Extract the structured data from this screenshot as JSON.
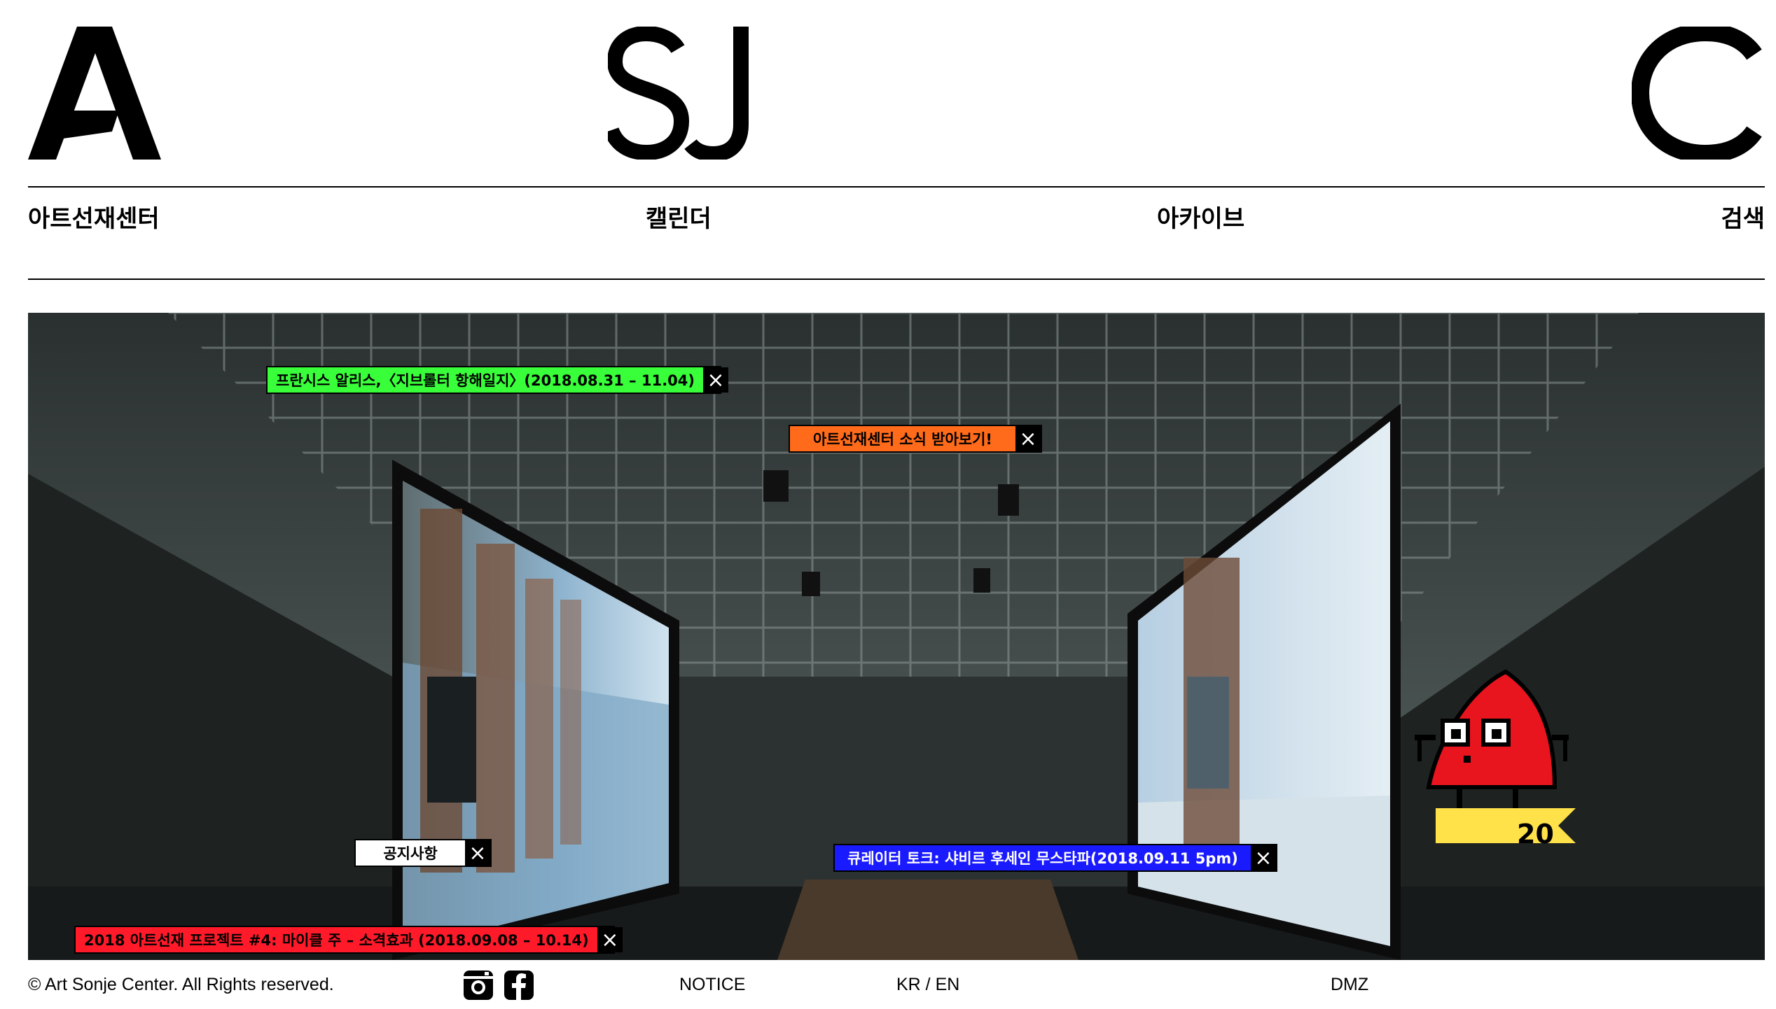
{
  "logo": {
    "letters": [
      "A",
      "SJ",
      "C"
    ]
  },
  "nav": {
    "items": [
      {
        "label": "아트선재센터"
      },
      {
        "label": "캘린더"
      },
      {
        "label": "아카이브"
      },
      {
        "label": "검색"
      }
    ]
  },
  "popups": [
    {
      "label": "프란시스 알리스,〈지브롤터 항해일지〉(2018.08.31 – 11.04)",
      "bg": "#39ff3a"
    },
    {
      "label": "아트선재센터 소식 받아보기!",
      "bg": "#ff6b1a"
    },
    {
      "label": "공지사항",
      "bg": "#ffffff"
    },
    {
      "label": "큐레이터 토크: 샤비르 후세인 무스타파(2018.09.11 5pm)",
      "bg": "#1a1aff"
    },
    {
      "label": "2018 아트선재 프로젝트 #4: 마이클 주 – 소격효과 (2018.09.08 – 10.14)",
      "bg": "#ff1a2a"
    }
  ],
  "close_icon": "×",
  "mascot": {
    "number": "20",
    "body_color": "#e8141e",
    "flag_color": "#ffe14a"
  },
  "footer": {
    "copyright": "© Art Sonje Center. All Rights reserved.",
    "notice": "NOTICE",
    "lang": "KR / EN",
    "dmz": "DMZ",
    "icons": [
      "instagram-icon",
      "facebook-icon"
    ]
  }
}
